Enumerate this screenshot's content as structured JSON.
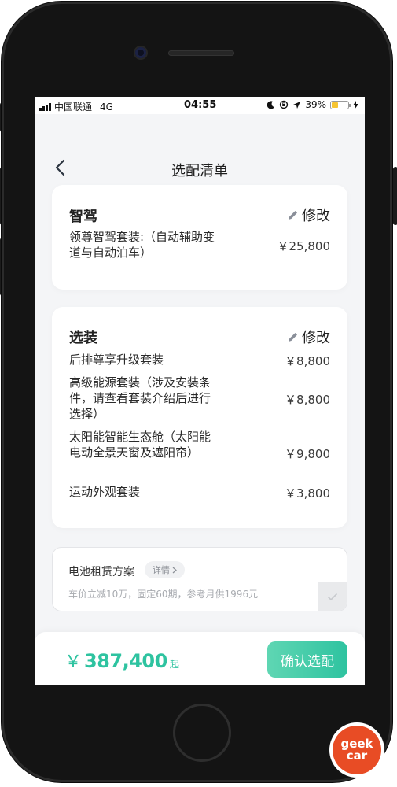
{
  "status_bar": {
    "carrier": "中国联通",
    "network": "4G",
    "time": "04:55",
    "battery_percent": "39%",
    "battery_level": 0.39
  },
  "nav": {
    "title": "选配清单",
    "back_icon": "chevron-left-icon"
  },
  "smart_drive": {
    "title": "智驾",
    "edit_label": "修改",
    "items": [
      {
        "name": "领尊智驾套装:（自动辅助变道与自动泊车）",
        "price": "￥25,800"
      }
    ]
  },
  "options": {
    "title": "选装",
    "edit_label": "修改",
    "items": [
      {
        "name": "后排尊享升级套装",
        "price": "￥8,800"
      },
      {
        "name": "高级能源套装（涉及安装条件，请查看套装介绍后进行选择）",
        "price": "￥8,800"
      },
      {
        "name": "太阳能智能生态舱（太阳能电动全景天窗及遮阳帘）",
        "price": "￥9,800"
      },
      {
        "name": "运动外观套装",
        "price": "￥3,800"
      }
    ]
  },
  "battery_plan": {
    "title": "电池租赁方案",
    "detail_label": "详情",
    "description": "车价立减10万，固定60期，参考月供1996元",
    "checked": false
  },
  "footer": {
    "currency": "￥",
    "total": "387,400",
    "suffix": "起",
    "confirm_label": "确认选配"
  },
  "colors": {
    "accent": "#2ec3a0",
    "battery": "#f7c531",
    "background": "#f4f5f7",
    "logo": "#e84c25"
  },
  "watermark": {
    "text": "geek car"
  }
}
